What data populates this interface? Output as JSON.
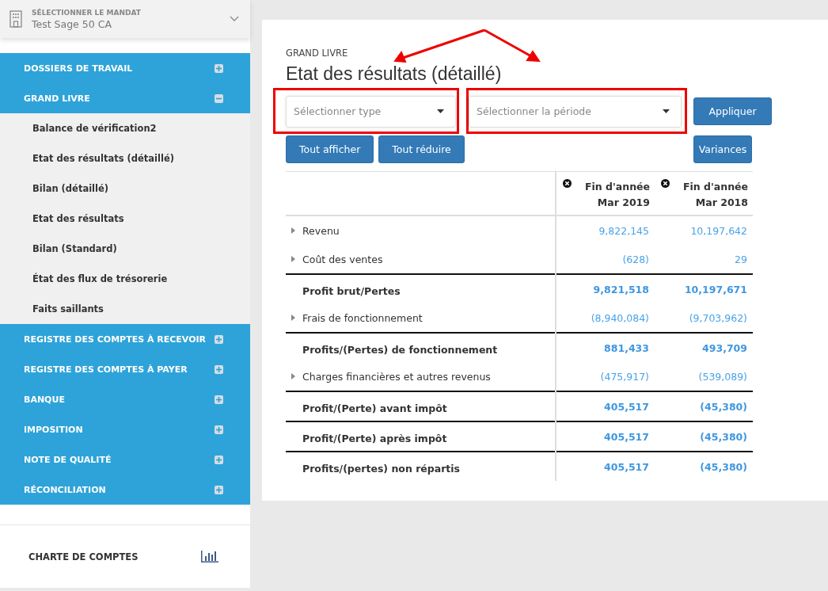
{
  "sidebar": {
    "mandate": {
      "label": "SÉLECTIONNER LE MANDAT",
      "value": "Test Sage 50 CA"
    },
    "menu": [
      {
        "label": "DOSSIERS DE TRAVAIL",
        "expanded": false
      },
      {
        "label": "GRAND LIVRE",
        "expanded": true,
        "children": [
          {
            "label": "Balance de vérification2"
          },
          {
            "label": "Etat des résultats (détaillé)"
          },
          {
            "label": "Bilan (détaillé)"
          },
          {
            "label": "Etat des résultats"
          },
          {
            "label": "Bilan (Standard)"
          },
          {
            "label": "État des flux de trésorerie"
          },
          {
            "label": "Faits saillants"
          }
        ]
      },
      {
        "label": "REGISTRE DES COMPTES À RECEVOIR",
        "expanded": false
      },
      {
        "label": "REGISTRE DES COMPTES À PAYER",
        "expanded": false
      },
      {
        "label": "BANQUE",
        "expanded": false
      },
      {
        "label": "IMPOSITION",
        "expanded": false
      },
      {
        "label": "NOTE DE QUALITÉ",
        "expanded": false
      },
      {
        "label": "RÉCONCILIATION",
        "expanded": false
      }
    ],
    "footer": {
      "label": "CHARTE DE COMPTES"
    }
  },
  "report": {
    "breadcrumb": "GRAND LIVRE",
    "title": "Etat des résultats (détaillé)",
    "selects": [
      {
        "placeholder": "Sélectionner type"
      },
      {
        "placeholder": "Sélectionner la période"
      }
    ],
    "buttons": {
      "apply": "Appliquer",
      "expand_all": "Tout afficher",
      "collapse_all": "Tout réduire",
      "variances": "Variances"
    },
    "table": {
      "columns": [
        {
          "line1": "Fin d'année",
          "line2": "Mar 2019"
        },
        {
          "line1": "Fin d'année",
          "line2": "Mar 2018"
        }
      ],
      "rows": [
        {
          "kind": "group",
          "label": "Revenu",
          "values": [
            "9,822,145",
            "10,197,642"
          ]
        },
        {
          "kind": "group",
          "label": "Coût des ventes",
          "values": [
            "(628)",
            "29"
          ]
        },
        {
          "kind": "total",
          "label": "Profit brut/Pertes",
          "values": [
            "9,821,518",
            "10,197,671"
          ]
        },
        {
          "kind": "group",
          "label": "Frais de fonctionnement",
          "values": [
            "(8,940,084)",
            "(9,703,962)"
          ]
        },
        {
          "kind": "total",
          "label": "Profits/(Pertes) de fonctionnement",
          "values": [
            "881,433",
            "493,709"
          ]
        },
        {
          "kind": "group",
          "label": "Charges financières et autres revenus",
          "values": [
            "(475,917)",
            "(539,089)"
          ]
        },
        {
          "kind": "total",
          "label": "Profit/(Perte) avant impôt",
          "values": [
            "405,517",
            "(45,380)"
          ]
        },
        {
          "kind": "total",
          "label": "Profit/(Perte) après impôt",
          "values": [
            "405,517",
            "(45,380)"
          ]
        },
        {
          "kind": "total",
          "label": "Profits/(pertes) non répartis",
          "values": [
            "405,517",
            "(45,380)"
          ]
        }
      ]
    }
  }
}
